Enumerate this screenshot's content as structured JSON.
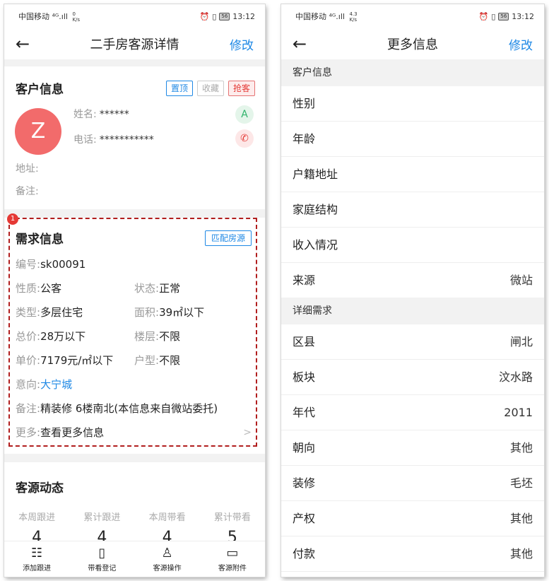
{
  "status": {
    "carrier": "中国移动",
    "signal": "⁴ᴳ.ıll",
    "speed_left": "0",
    "speed_right": "4.3",
    "speed_unit": "K/s",
    "battery": "56",
    "time": "13:12"
  },
  "left": {
    "title": "二手房客源详情",
    "edit": "修改",
    "customer": {
      "heading": "客户信息",
      "tags": [
        "置顶",
        "收藏",
        "抢客"
      ],
      "avatar_letter": "Z",
      "name_label": "姓名:",
      "name_value": "******",
      "phone_label": "电话:",
      "phone_value": "***********",
      "grade": "A",
      "address_label": "地址:",
      "remark_label": "备注:"
    },
    "demand": {
      "badge": "1",
      "heading": "需求信息",
      "match_btn": "匹配房源",
      "code_k": "编号:",
      "code_v": "sk00091",
      "nature_k": "性质:",
      "nature_v": "公客",
      "state_k": "状态:",
      "state_v": "正常",
      "type_k": "类型:",
      "type_v": "多层住宅",
      "area_k": "面积:",
      "area_v": "39㎡以下",
      "total_k": "总价:",
      "total_v": "28万以下",
      "floor_k": "楼层:",
      "floor_v": "不限",
      "unit_k": "单价:",
      "unit_v": "7179元/㎡以下",
      "layout_k": "户型:",
      "layout_v": "不限",
      "intent_k": "意向:",
      "intent_v": "大宁城",
      "remark_k": "备注:",
      "remark_v": "精装修 6楼南北(本信息来自微站委托)",
      "more_k": "更多:",
      "more_v": "查看更多信息",
      "arrow": ">"
    },
    "dynamics": {
      "heading": "客源动态",
      "stats": [
        {
          "label": "本周跟进",
          "value": "4"
        },
        {
          "label": "累计跟进",
          "value": "4"
        },
        {
          "label": "本周带看",
          "value": "4"
        },
        {
          "label": "累计带看",
          "value": "5"
        }
      ]
    },
    "tabs": [
      {
        "label": "添加跟进",
        "icon": "☷"
      },
      {
        "label": "带看登记",
        "icon": "▯"
      },
      {
        "label": "客源操作",
        "icon": "♙"
      },
      {
        "label": "客源附件",
        "icon": "▭"
      }
    ]
  },
  "right": {
    "title": "更多信息",
    "edit": "修改",
    "section1": "客户信息",
    "rows1": [
      {
        "label": "性别",
        "value": ""
      },
      {
        "label": "年龄",
        "value": ""
      },
      {
        "label": "户籍地址",
        "value": ""
      },
      {
        "label": "家庭结构",
        "value": ""
      },
      {
        "label": "收入情况",
        "value": ""
      },
      {
        "label": "来源",
        "value": "微站"
      }
    ],
    "section2": "详细需求",
    "rows2": [
      {
        "label": "区县",
        "value": "闸北"
      },
      {
        "label": "板块",
        "value": "汶水路"
      },
      {
        "label": "年代",
        "value": "2011"
      },
      {
        "label": "朝向",
        "value": "其他"
      },
      {
        "label": "装修",
        "value": "毛坯"
      },
      {
        "label": "产权",
        "value": "其他"
      },
      {
        "label": "付款",
        "value": "其他"
      }
    ]
  }
}
